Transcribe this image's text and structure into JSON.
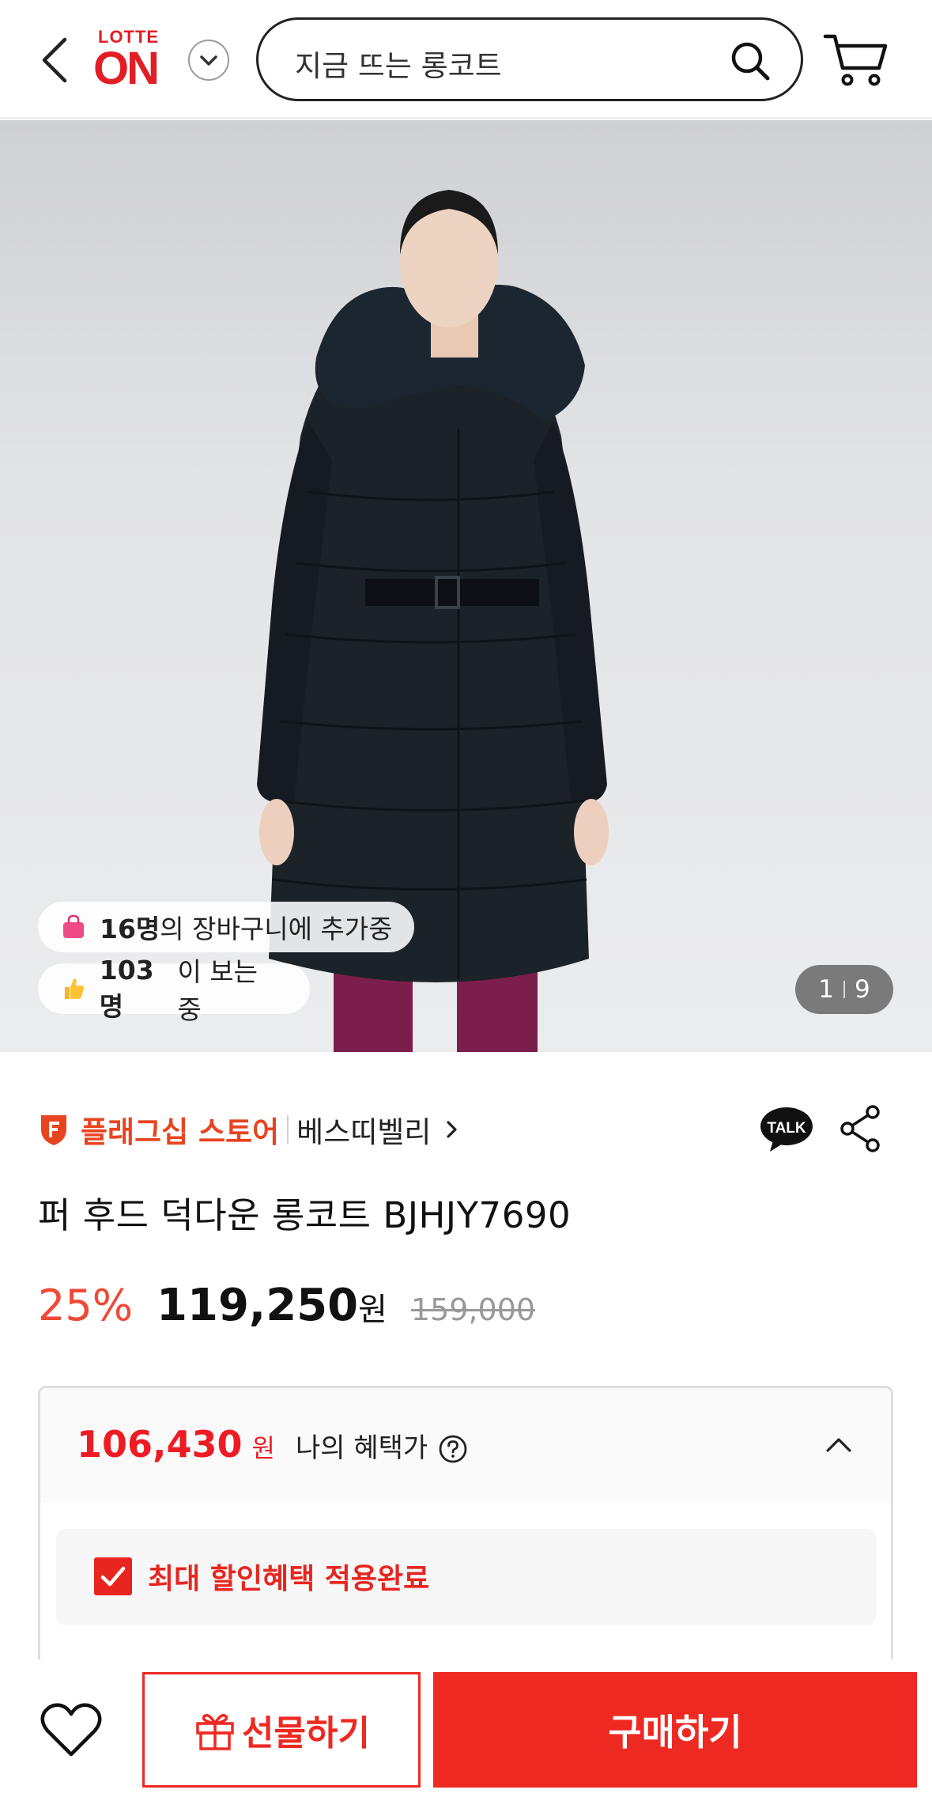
{
  "header": {
    "logo_top": "LOTTE",
    "logo_main": "ON",
    "search_placeholder": "지금 뜨는 롱코트"
  },
  "hero": {
    "cart_count": "16명",
    "cart_suffix": "의 장바구니에 추가중",
    "view_count": "103명",
    "view_suffix": "이 보는 중",
    "image_index": "1",
    "image_total": "9",
    "colors": {
      "coat": "#1b2228",
      "fur": "#1c2630",
      "pants": "#7b1e4b",
      "background": "#e3e4e7"
    }
  },
  "store": {
    "type": "플래그십 스토어",
    "name": "베스띠벨리"
  },
  "product": {
    "title": "퍼 후드 덕다운 롱코트  BJHJY7690",
    "discount": "25%",
    "price": "119,250",
    "currency": "원",
    "original_price": "159,000"
  },
  "benefit": {
    "amount": "106,430",
    "currency": "원",
    "label": "나의 혜택가",
    "applied_text": "최대 할인혜택 적용완료"
  },
  "bottom": {
    "gift_label": "선물하기",
    "buy_label": "구매하기"
  },
  "theme": {
    "accent": "#ee2922",
    "store_orange": "#e8441f"
  }
}
